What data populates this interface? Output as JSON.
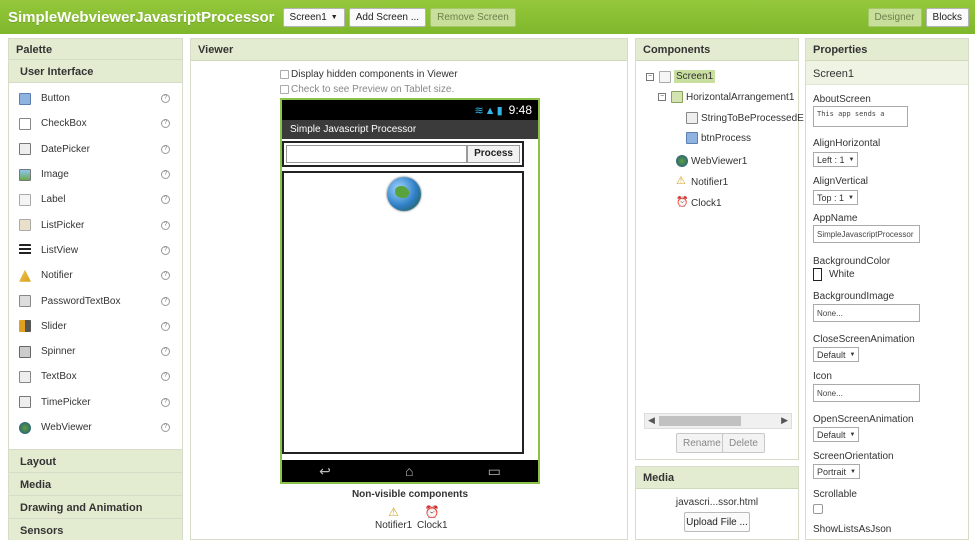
{
  "app": {
    "title": "SimpleWebviewerJavasriptProcessor",
    "screen_select": "Screen1",
    "add_screen": "Add Screen ...",
    "remove_screen": "Remove Screen",
    "designer": "Designer",
    "blocks": "Blocks"
  },
  "palette": {
    "title": "Palette",
    "category": "User Interface",
    "items": [
      {
        "label": "Button",
        "icon": "button-icon"
      },
      {
        "label": "CheckBox",
        "icon": "checkbox-icon"
      },
      {
        "label": "DatePicker",
        "icon": "datepicker-icon"
      },
      {
        "label": "Image",
        "icon": "image-icon"
      },
      {
        "label": "Label",
        "icon": "label-icon"
      },
      {
        "label": "ListPicker",
        "icon": "listpicker-icon"
      },
      {
        "label": "ListView",
        "icon": "listview-icon"
      },
      {
        "label": "Notifier",
        "icon": "notifier-icon"
      },
      {
        "label": "PasswordTextBox",
        "icon": "passwordtextbox-icon"
      },
      {
        "label": "Slider",
        "icon": "slider-icon"
      },
      {
        "label": "Spinner",
        "icon": "spinner-icon"
      },
      {
        "label": "TextBox",
        "icon": "textbox-icon"
      },
      {
        "label": "TimePicker",
        "icon": "timepicker-icon"
      },
      {
        "label": "WebViewer",
        "icon": "webviewer-icon"
      }
    ],
    "categories": [
      "Layout",
      "Media",
      "Drawing and Animation",
      "Sensors"
    ]
  },
  "viewer": {
    "title": "Viewer",
    "show_hidden": "Display hidden components in Viewer",
    "tablet_preview": "Check to see Preview on Tablet size.",
    "time": "9:48",
    "screen_title": "Simple Javascript Processor",
    "process_button": "Process",
    "nonvisible_title": "Non-visible components",
    "nonvisible": [
      "Notifier1",
      "Clock1"
    ]
  },
  "components": {
    "title": "Components",
    "tree": {
      "screen": "Screen1",
      "harrangement": "HorizontalArrangement1",
      "textbox": "StringToBeProcessedE",
      "button": "btnProcess",
      "webviewer": "WebViewer1",
      "notifier": "Notifier1",
      "clock": "Clock1"
    },
    "rename": "Rename",
    "delete": "Delete"
  },
  "media": {
    "title": "Media",
    "file": "javascri...ssor.html",
    "upload": "Upload File ..."
  },
  "properties": {
    "title": "Properties",
    "component": "Screen1",
    "about_label": "AboutScreen",
    "about_value": "This app sends a",
    "alignh_label": "AlignHorizontal",
    "alignh_value": "Left : 1",
    "alignv_label": "AlignVertical",
    "alignv_value": "Top : 1",
    "appname_label": "AppName",
    "appname_value": "SimpleJavascriptProcessor",
    "bgcolor_label": "BackgroundColor",
    "bgcolor_value": "White",
    "bgimage_label": "BackgroundImage",
    "bgimage_value": "None...",
    "closeanim_label": "CloseScreenAnimation",
    "closeanim_value": "Default",
    "icon_label": "Icon",
    "icon_value": "None...",
    "openanim_label": "OpenScreenAnimation",
    "openanim_value": "Default",
    "orientation_label": "ScreenOrientation",
    "orientation_value": "Portrait",
    "scrollable_label": "Scrollable",
    "showlists_label": "ShowListsAsJson"
  },
  "colors": {
    "accent": "#8bc34a",
    "panel_header": "#e3ecd1",
    "selection": "#c9df9f"
  }
}
